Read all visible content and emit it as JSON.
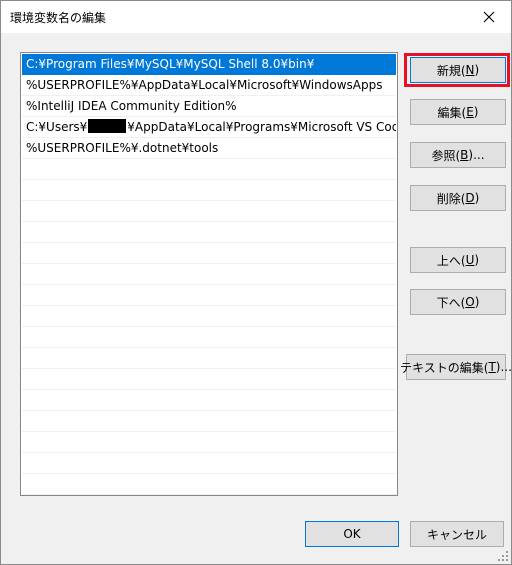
{
  "window": {
    "title": "環境変数名の編集",
    "close_icon": "close-icon"
  },
  "path_list": [
    {
      "text": "C:¥Program Files¥MySQL¥MySQL Shell 8.0¥bin¥",
      "selected": true
    },
    {
      "text": "%USERPROFILE%¥AppData¥Local¥Microsoft¥WindowsApps",
      "selected": false
    },
    {
      "text": "%IntelliJ IDEA Community Edition%",
      "selected": false
    },
    {
      "text_before": "C:¥Users¥",
      "redacted": true,
      "text_after": "¥AppData¥Local¥Programs¥Microsoft VS Code...",
      "selected": false
    },
    {
      "text": "%USERPROFILE%¥.dotnet¥tools",
      "selected": false
    }
  ],
  "buttons": {
    "new": {
      "label": "新規(",
      "key": "N",
      "suffix": ")"
    },
    "edit": {
      "label": "編集(",
      "key": "E",
      "suffix": ")"
    },
    "browse": {
      "label": "参照(",
      "key": "B",
      "suffix": ")..."
    },
    "delete": {
      "label": "削除(",
      "key": "D",
      "suffix": ")"
    },
    "move_up": {
      "label": "上へ(",
      "key": "U",
      "suffix": ")"
    },
    "move_down": {
      "label": "下へ(",
      "key": "O",
      "suffix": ")"
    },
    "edit_text": {
      "label": "テキストの編集(",
      "key": "T",
      "suffix": ")..."
    },
    "ok": "OK",
    "cancel": "キャンセル"
  },
  "colors": {
    "selection": "#0078d7",
    "highlight_box": "#e81123"
  }
}
